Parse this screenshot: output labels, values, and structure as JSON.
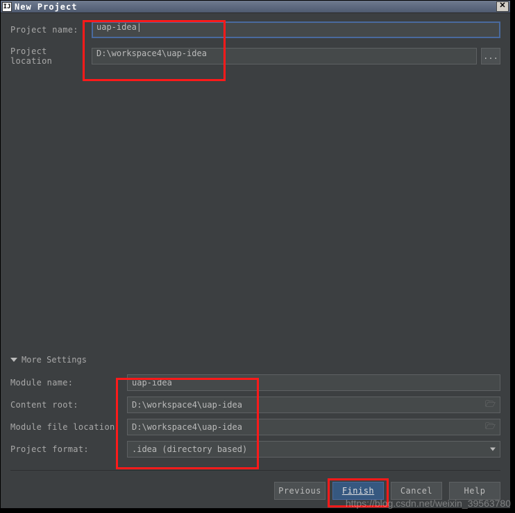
{
  "titlebar": {
    "title": "New Project",
    "app_icon_label": "IJ"
  },
  "form": {
    "project_name_label": "Project name:",
    "project_name_value": "uap-idea",
    "project_location_label": "Project location",
    "project_location_value": "D:\\workspace4\\uap-idea",
    "browse_label": "..."
  },
  "more": {
    "header": "More Settings",
    "module_name_label": "Module name:",
    "module_name_value": "uap-idea",
    "content_root_label": "Content root:",
    "content_root_value": "D:\\workspace4\\uap-idea",
    "module_file_location_label": "Module file location:",
    "module_file_location_value": "D:\\workspace4\\uap-idea",
    "project_format_label": "Project format:",
    "project_format_value": ".idea (directory based)"
  },
  "buttons": {
    "previous": "Previous",
    "finish": "Finish",
    "cancel": "Cancel",
    "help": "Help"
  },
  "watermark": "https://blog.csdn.net/weixin_39563780"
}
